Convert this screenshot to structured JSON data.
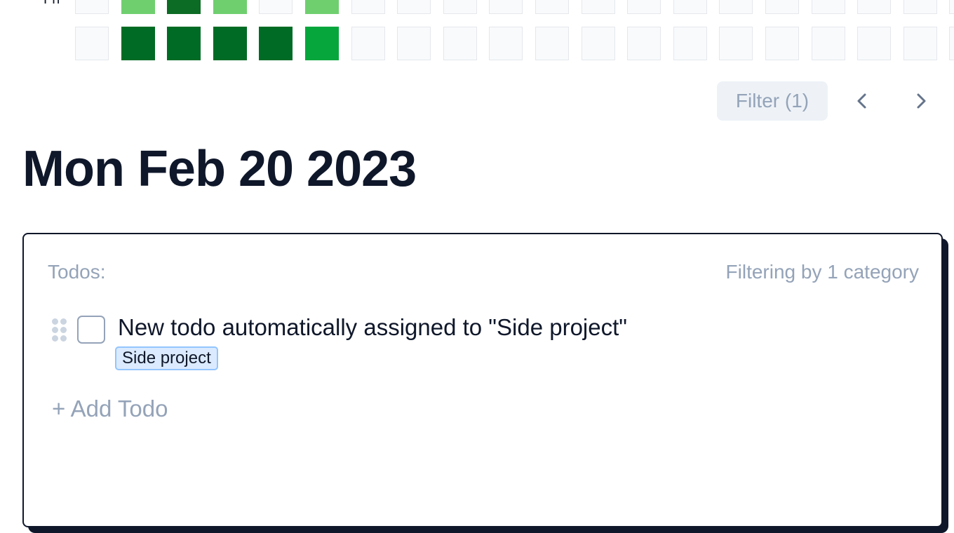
{
  "heatmap": {
    "visible_day_label": "Fri",
    "rows": [
      {
        "levels": [
          0,
          1,
          2,
          1,
          0,
          1,
          0,
          0,
          0,
          0,
          0,
          0,
          0,
          0,
          0,
          0,
          0,
          0,
          0,
          0
        ]
      },
      {
        "levels": [
          0,
          4,
          4,
          4,
          4,
          3,
          0,
          0,
          0,
          0,
          0,
          0,
          0,
          0,
          0,
          0,
          0,
          0,
          0,
          0
        ]
      }
    ],
    "colors": {
      "empty": "#f8fafc",
      "level1": "#6fcf6f",
      "level2": "#0c6b24",
      "level3": "#06a63c",
      "level4": "#006b24"
    }
  },
  "controls": {
    "filter_label": "Filter (1)",
    "prev_icon": "chevron-left-icon",
    "next_icon": "chevron-right-icon"
  },
  "date_title": "Mon Feb 20 2023",
  "todos_panel": {
    "heading": "Todos:",
    "filter_status": "Filtering by 1 category",
    "items": [
      {
        "text": "New todo automatically assigned to \"Side project\"",
        "checked": false,
        "category": "Side project"
      }
    ],
    "add_label": "+ Add Todo"
  },
  "colors": {
    "text_dark": "#0f172a",
    "muted": "#94a3b8",
    "tag_bg": "#dbeafe",
    "tag_border": "#93c5fd"
  }
}
